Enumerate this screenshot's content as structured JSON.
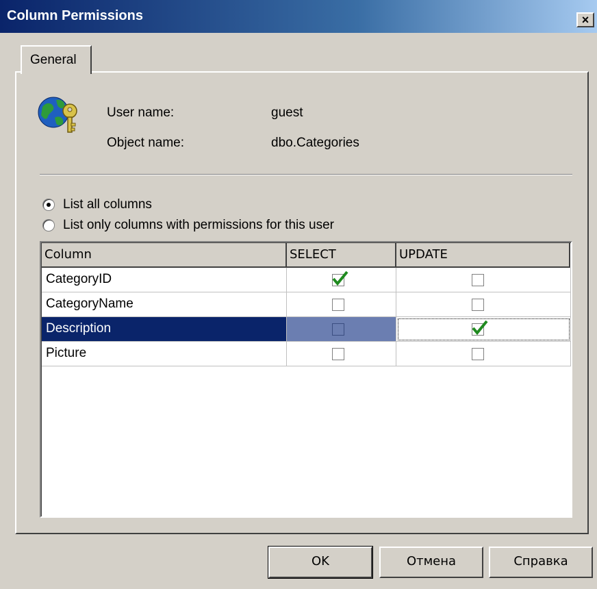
{
  "window": {
    "title": "Column Permissions",
    "close_glyph": "×"
  },
  "tabs": [
    {
      "label": "General"
    }
  ],
  "info": {
    "icon": "globe-key-icon",
    "user_label": "User name:",
    "user_value": "guest",
    "object_label": "Object name:",
    "object_value": "dbo.Categories"
  },
  "filter": {
    "options": [
      {
        "label": "List all columns",
        "selected": true
      },
      {
        "label": "List only columns with permissions for this user",
        "selected": false
      }
    ]
  },
  "grid": {
    "headers": [
      "Column",
      "SELECT",
      "UPDATE"
    ],
    "rows": [
      {
        "name": "CategoryID",
        "select": true,
        "update": false
      },
      {
        "name": "CategoryName",
        "select": false,
        "update": false
      },
      {
        "name": "Description",
        "select": false,
        "update": true,
        "selected": true
      },
      {
        "name": "Picture",
        "select": false,
        "update": false
      }
    ]
  },
  "buttons": {
    "ok": "OK",
    "cancel": "Отмена",
    "help": "Справка"
  },
  "colors": {
    "selection": "#0a246a",
    "check": "#1f8a1f",
    "face": "#d4d0c8"
  }
}
